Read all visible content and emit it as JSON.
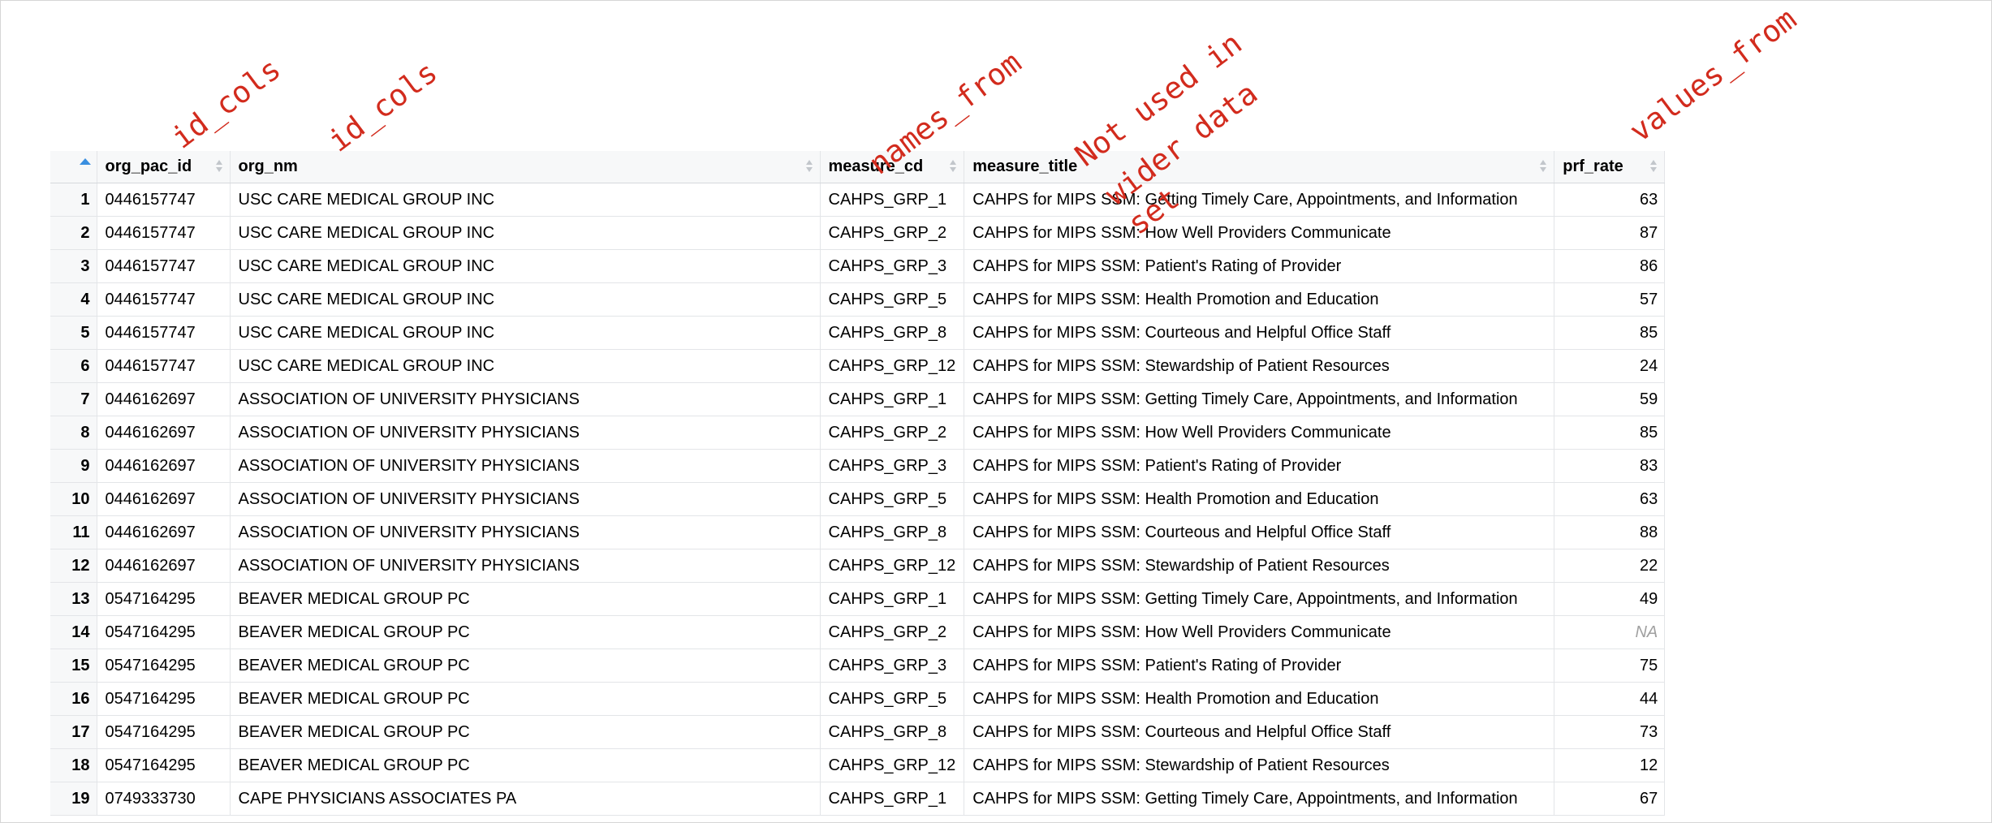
{
  "annotations": {
    "id_cols_1": "id_cols",
    "id_cols_2": "id_cols",
    "names_from": "names_from",
    "not_used": [
      "Not used in",
      "wider data",
      "set"
    ],
    "values_from": "values_from"
  },
  "table": {
    "columns": [
      "org_pac_id",
      "org_nm",
      "measure_cd",
      "measure_title",
      "prf_rate"
    ],
    "rows": [
      [
        "1",
        "0446157747",
        "USC CARE MEDICAL GROUP INC",
        "CAHPS_GRP_1",
        "CAHPS for MIPS SSM: Getting Timely Care, Appointments, and Information",
        "63"
      ],
      [
        "2",
        "0446157747",
        "USC CARE MEDICAL GROUP INC",
        "CAHPS_GRP_2",
        "CAHPS for MIPS SSM: How Well Providers Communicate",
        "87"
      ],
      [
        "3",
        "0446157747",
        "USC CARE MEDICAL GROUP INC",
        "CAHPS_GRP_3",
        "CAHPS for MIPS SSM: Patient's Rating of Provider",
        "86"
      ],
      [
        "4",
        "0446157747",
        "USC CARE MEDICAL GROUP INC",
        "CAHPS_GRP_5",
        "CAHPS for MIPS SSM: Health Promotion and Education",
        "57"
      ],
      [
        "5",
        "0446157747",
        "USC CARE MEDICAL GROUP INC",
        "CAHPS_GRP_8",
        "CAHPS for MIPS SSM: Courteous and Helpful Office Staff",
        "85"
      ],
      [
        "6",
        "0446157747",
        "USC CARE MEDICAL GROUP INC",
        "CAHPS_GRP_12",
        "CAHPS for MIPS SSM: Stewardship of Patient Resources",
        "24"
      ],
      [
        "7",
        "0446162697",
        "ASSOCIATION OF UNIVERSITY PHYSICIANS",
        "CAHPS_GRP_1",
        "CAHPS for MIPS SSM: Getting Timely Care, Appointments, and Information",
        "59"
      ],
      [
        "8",
        "0446162697",
        "ASSOCIATION OF UNIVERSITY PHYSICIANS",
        "CAHPS_GRP_2",
        "CAHPS for MIPS SSM: How Well Providers Communicate",
        "85"
      ],
      [
        "9",
        "0446162697",
        "ASSOCIATION OF UNIVERSITY PHYSICIANS",
        "CAHPS_GRP_3",
        "CAHPS for MIPS SSM: Patient's Rating of Provider",
        "83"
      ],
      [
        "10",
        "0446162697",
        "ASSOCIATION OF UNIVERSITY PHYSICIANS",
        "CAHPS_GRP_5",
        "CAHPS for MIPS SSM: Health Promotion and Education",
        "63"
      ],
      [
        "11",
        "0446162697",
        "ASSOCIATION OF UNIVERSITY PHYSICIANS",
        "CAHPS_GRP_8",
        "CAHPS for MIPS SSM: Courteous and Helpful Office Staff",
        "88"
      ],
      [
        "12",
        "0446162697",
        "ASSOCIATION OF UNIVERSITY PHYSICIANS",
        "CAHPS_GRP_12",
        "CAHPS for MIPS SSM: Stewardship of Patient Resources",
        "22"
      ],
      [
        "13",
        "0547164295",
        "BEAVER MEDICAL GROUP PC",
        "CAHPS_GRP_1",
        "CAHPS for MIPS SSM: Getting Timely Care, Appointments, and Information",
        "49"
      ],
      [
        "14",
        "0547164295",
        "BEAVER MEDICAL GROUP PC",
        "CAHPS_GRP_2",
        "CAHPS for MIPS SSM: How Well Providers Communicate",
        "NA"
      ],
      [
        "15",
        "0547164295",
        "BEAVER MEDICAL GROUP PC",
        "CAHPS_GRP_3",
        "CAHPS for MIPS SSM: Patient's Rating of Provider",
        "75"
      ],
      [
        "16",
        "0547164295",
        "BEAVER MEDICAL GROUP PC",
        "CAHPS_GRP_5",
        "CAHPS for MIPS SSM: Health Promotion and Education",
        "44"
      ],
      [
        "17",
        "0547164295",
        "BEAVER MEDICAL GROUP PC",
        "CAHPS_GRP_8",
        "CAHPS for MIPS SSM: Courteous and Helpful Office Staff",
        "73"
      ],
      [
        "18",
        "0547164295",
        "BEAVER MEDICAL GROUP PC",
        "CAHPS_GRP_12",
        "CAHPS for MIPS SSM: Stewardship of Patient Resources",
        "12"
      ],
      [
        "19",
        "0749333730",
        "CAPE PHYSICIANS ASSOCIATES PA",
        "CAHPS_GRP_1",
        "CAHPS for MIPS SSM: Getting Timely Care, Appointments, and Information",
        "67"
      ]
    ]
  }
}
